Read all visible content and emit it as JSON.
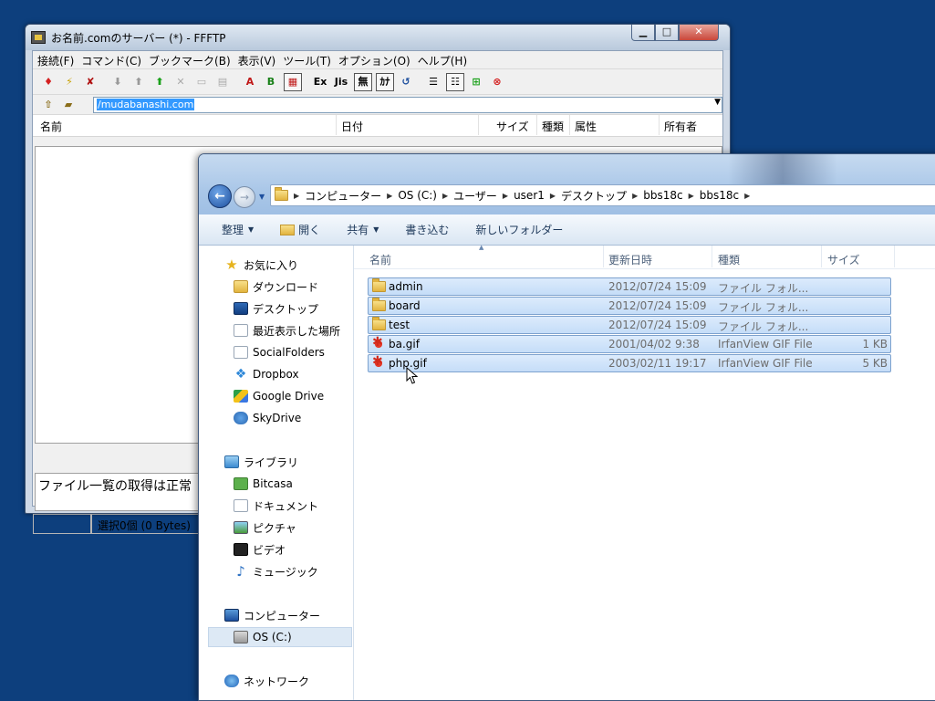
{
  "ffftp": {
    "title": "お名前.comのサーバー (*) - FFFTP",
    "menu": [
      "接続(F)",
      "コマンド(C)",
      "ブックマーク(B)",
      "表示(V)",
      "ツール(T)",
      "オプション(O)",
      "ヘルプ(H)"
    ],
    "toolbar": {
      "ascii_label": "A",
      "binary_label": "B",
      "euc_label": "Ex",
      "jis_label": "Jis",
      "nochange_label": "無",
      "kana_label": "ｶﾅ"
    },
    "path": "/mudabanashi.com",
    "columns": {
      "name": "名前",
      "date": "日付",
      "size": "サイズ",
      "type": "種類",
      "attr": "属性",
      "owner": "所有者"
    },
    "log_text": "ファイル一覧の取得は正常",
    "status": {
      "selection": "選択0個 (0 Bytes)"
    }
  },
  "explorer": {
    "breadcrumb": [
      "コンピューター",
      "OS (C:)",
      "ユーザー",
      "user1",
      "デスクトップ",
      "bbs18c",
      "bbs18c"
    ],
    "commands": {
      "organize": "整理",
      "open": "開く",
      "share": "共有",
      "burn": "書き込む",
      "new_folder": "新しいフォルダー"
    },
    "nav": {
      "favorites": "お気に入り",
      "favorites_items": [
        "ダウンロード",
        "デスクトップ",
        "最近表示した場所",
        "SocialFolders",
        "Dropbox",
        "Google Drive",
        "SkyDrive"
      ],
      "libraries": "ライブラリ",
      "libraries_items": [
        "Bitcasa",
        "ドキュメント",
        "ピクチャ",
        "ビデオ",
        "ミュージック"
      ],
      "computer": "コンピューター",
      "computer_items": [
        "OS (C:)"
      ],
      "network": "ネットワーク"
    },
    "columns": {
      "name": "名前",
      "date": "更新日時",
      "type": "種類",
      "size": "サイズ"
    },
    "files": [
      {
        "name": "admin",
        "date": "2012/07/24 15:09",
        "type": "ファイル フォル...",
        "size": "",
        "icon": "folder-icon"
      },
      {
        "name": "board",
        "date": "2012/07/24 15:09",
        "type": "ファイル フォル...",
        "size": "",
        "icon": "folder-icon"
      },
      {
        "name": "test",
        "date": "2012/07/24 15:09",
        "type": "ファイル フォル...",
        "size": "",
        "icon": "folder-icon"
      },
      {
        "name": "ba.gif",
        "date": "2001/04/02 9:38",
        "type": "IrfanView GIF File",
        "size": "1 KB",
        "icon": "gif-file-icon"
      },
      {
        "name": "php.gif",
        "date": "2003/02/11 19:17",
        "type": "IrfanView GIF File",
        "size": "5 KB",
        "icon": "gif-file-icon"
      }
    ]
  },
  "colors": {
    "desktop": "#0d3f7d",
    "selection": "#c5ddf8",
    "selection_border": "#7da2ce"
  }
}
